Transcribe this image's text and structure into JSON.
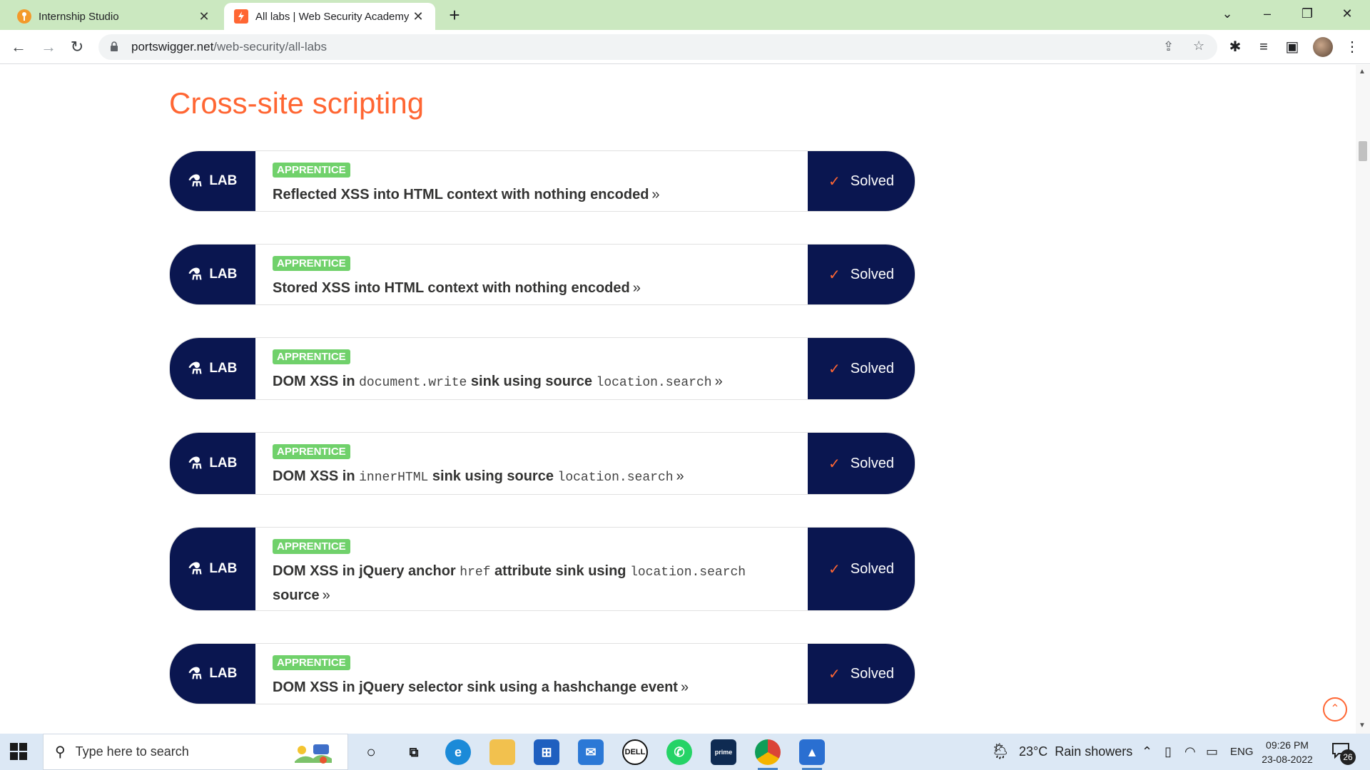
{
  "browser": {
    "tabs": [
      {
        "title": "Internship Studio",
        "favicon": "internship-studio-icon",
        "active": false
      },
      {
        "title": "All labs | Web Security Academy",
        "favicon": "portswigger-icon",
        "active": true
      }
    ],
    "url": {
      "host": "portswigger.net",
      "path": "/web-security/all-labs"
    }
  },
  "page": {
    "section_title": "Cross-site scripting",
    "tag_label": "LAB",
    "status_label": "Solved",
    "labs": [
      {
        "level": "APPRENTICE",
        "parts": [
          {
            "t": "Reflected XSS into HTML context with nothing encoded",
            "code": false
          }
        ]
      },
      {
        "level": "APPRENTICE",
        "parts": [
          {
            "t": "Stored XSS into HTML context with nothing encoded",
            "code": false
          }
        ]
      },
      {
        "level": "APPRENTICE",
        "parts": [
          {
            "t": "DOM XSS in ",
            "code": false
          },
          {
            "t": "document.write",
            "code": true
          },
          {
            "t": " sink using source ",
            "code": false
          },
          {
            "t": "location.search",
            "code": true
          }
        ]
      },
      {
        "level": "APPRENTICE",
        "parts": [
          {
            "t": "DOM XSS in ",
            "code": false
          },
          {
            "t": "innerHTML",
            "code": true
          },
          {
            "t": " sink using source ",
            "code": false
          },
          {
            "t": "location.search",
            "code": true
          }
        ]
      },
      {
        "level": "APPRENTICE",
        "parts": [
          {
            "t": "DOM XSS in jQuery anchor ",
            "code": false
          },
          {
            "t": "href",
            "code": true
          },
          {
            "t": " attribute sink using ",
            "code": false
          },
          {
            "t": "location.search",
            "code": true
          },
          {
            "t": " source",
            "code": false
          }
        ]
      },
      {
        "level": "APPRENTICE",
        "parts": [
          {
            "t": "DOM XSS in jQuery selector sink using a hashchange event",
            "code": false
          }
        ]
      }
    ]
  },
  "taskbar": {
    "search_placeholder": "Type here to search",
    "weather": {
      "temp": "23°C",
      "text": "Rain showers"
    },
    "language": "ENG",
    "time": "09:26 PM",
    "date": "23-08-2022",
    "notifications": "26"
  },
  "colors": {
    "accent": "#ff6633",
    "navy": "#0a1650",
    "level_green": "#70d16b"
  }
}
